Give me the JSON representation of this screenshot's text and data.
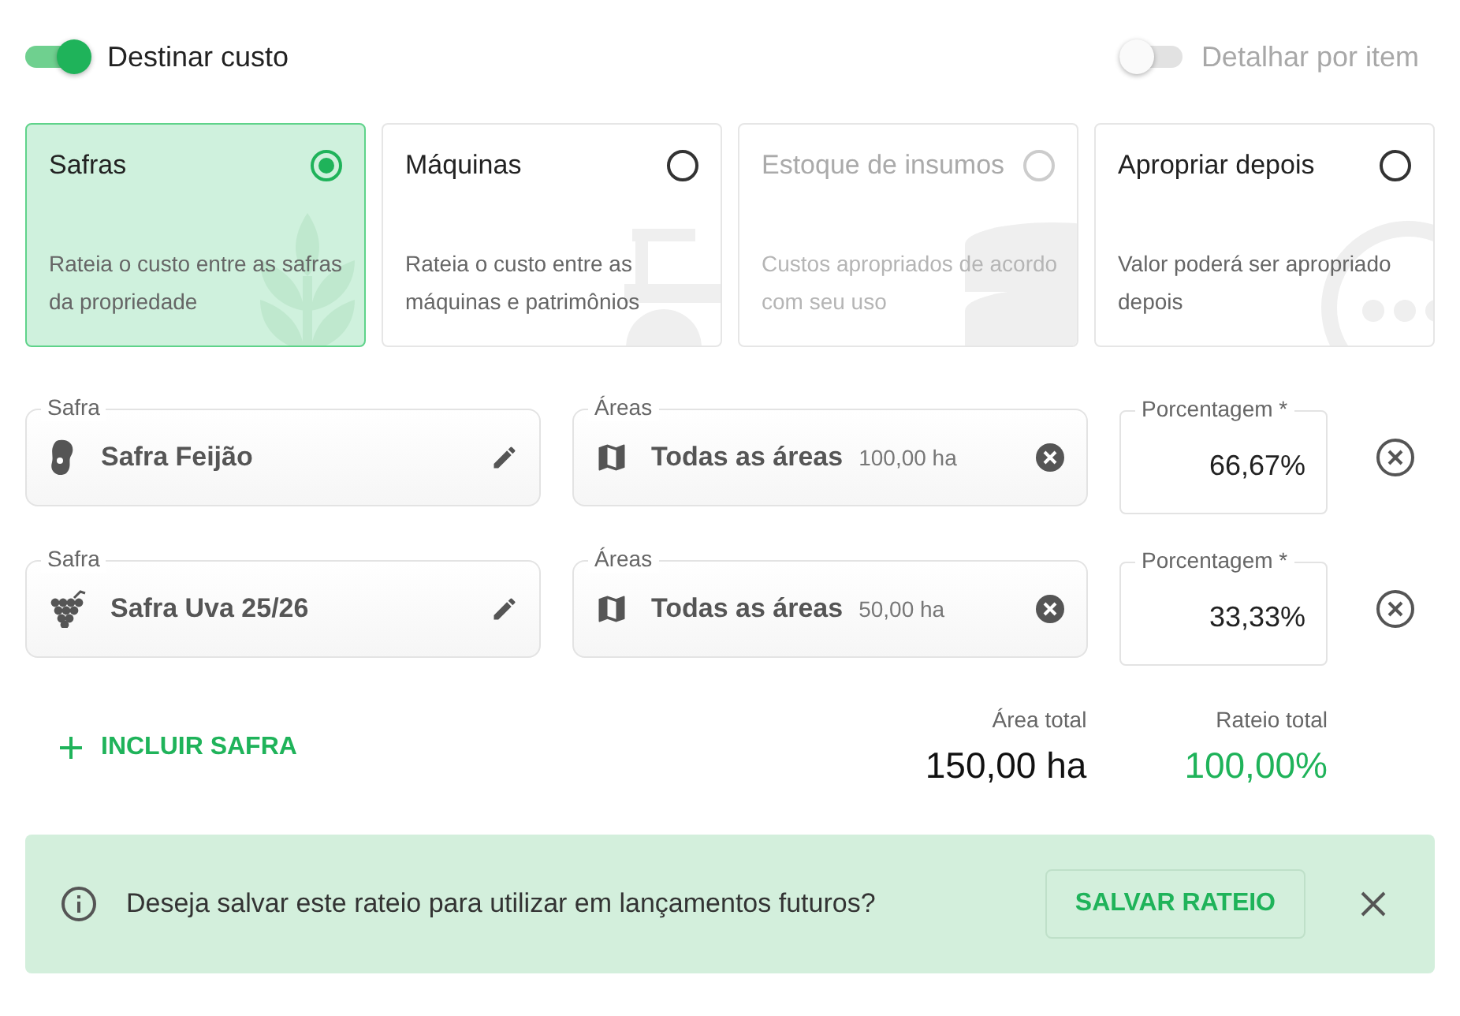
{
  "toggles": [
    {
      "label": "Destinar custo",
      "on": true,
      "disabled": false
    },
    {
      "label": "Detalhar por item",
      "on": false,
      "disabled": true
    }
  ],
  "options": [
    {
      "kind": "crops",
      "title": "Safras",
      "description": "Rateia o custo entre as safras da propriedade",
      "selected": true,
      "disabled": false
    },
    {
      "kind": "machines",
      "title": "Máquinas",
      "description": "Rateia o custo entre as máquinas e patrimônios",
      "selected": false,
      "disabled": false
    },
    {
      "kind": "stock",
      "title": "Estoque de insumos",
      "description": "Custos apropriados de acordo com seu uso",
      "selected": false,
      "disabled": true
    },
    {
      "kind": "later",
      "title": "Apropriar depois",
      "description": "Valor poderá ser apropriado depois",
      "selected": false,
      "disabled": false
    }
  ],
  "allocations": [
    {
      "crop_label": "Safra",
      "kind": "bean",
      "crop": "Safra Feijão",
      "areas_label": "Áreas",
      "areas": "Todas as áreas",
      "area_size": "100,00 ha",
      "percent_label": "Porcentagem *",
      "percent": "66,67%"
    },
    {
      "crop_label": "Safra",
      "kind": "grape",
      "crop": "Safra Uva 25/26",
      "areas_label": "Áreas",
      "areas": "Todas as áreas",
      "area_size": "50,00 ha",
      "percent_label": "Porcentagem *",
      "percent": "33,33%"
    }
  ],
  "add_button": "INCLUIR SAFRA",
  "totals": [
    {
      "label": "Área total",
      "value": "150,00 ha",
      "highlight": false
    },
    {
      "label": "Rateio total",
      "value": "100,00%",
      "highlight": true
    }
  ],
  "banner": {
    "message": "Deseja salvar este rateio para utilizar em lançamentos futuros?",
    "button": "SALVAR RATEIO"
  }
}
